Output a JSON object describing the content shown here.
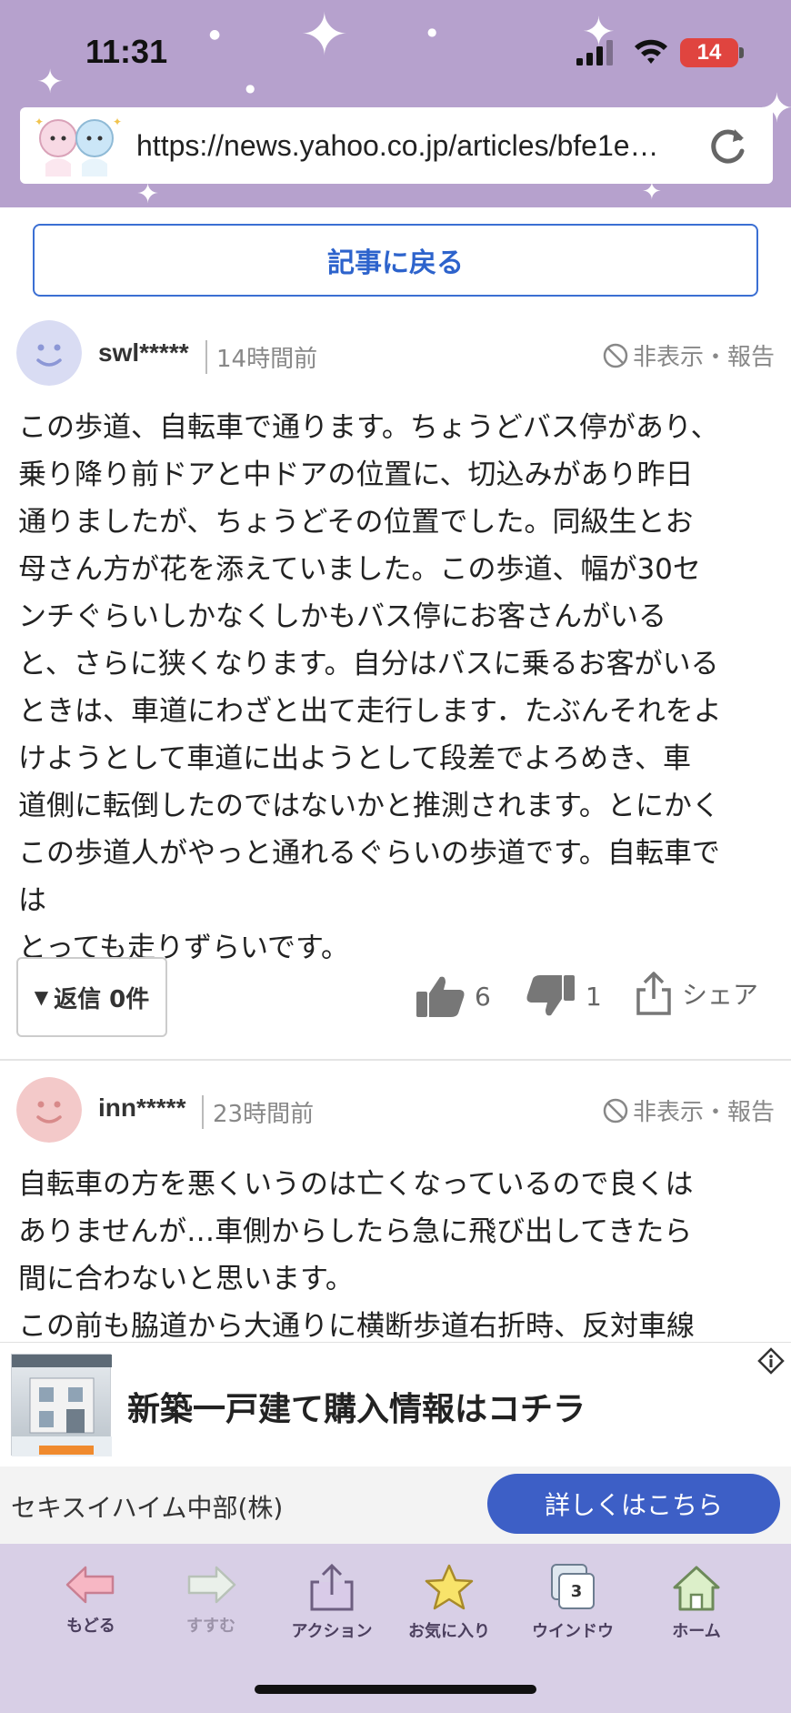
{
  "status": {
    "time": "11:31",
    "battery": "14"
  },
  "browser": {
    "url": "https://news.yahoo.co.jp/articles/bfe1e…"
  },
  "page": {
    "back_label": "記事に戻る"
  },
  "comments": [
    {
      "user": "swl*****",
      "time": "14時間前",
      "hide_report": "非表示・報告",
      "text": "この歩道、自転車で通ります。ちょうどバス停があり、\n乗り降り前ドアと中ドアの位置に、切込みがあり昨日\n通りましたが、ちょうどその位置でした。同級生とお\n母さん方が花を添えていました。この歩道、幅が30セ\nンチぐらいしかなくしかもバス停にお客さんがいる\nと、さらに狭くなります。自分はバスに乗るお客がいる\nときは、車道にわざと出て走行します．たぶんそれをよ\nけようとして車道に出ようとして段差でよろめき、車\n道側に転倒したのではないかと推測されます。とにかく\nこの歩道人がやっと通れるぐらいの歩道です。自転車で\nは\nとっても走りずらいです。",
      "reply_label": "返信 0件",
      "likes": "6",
      "dislikes": "1",
      "share_label": "シェア",
      "avatar_color": "#d9dcf3"
    },
    {
      "user": "inn*****",
      "time": "23時間前",
      "hide_report": "非表示・報告",
      "text": "自転車の方を悪くいうのは亡くなっているので良くは\nありませんが…車側からしたら急に飛び出してきたら\n間に合わないと思います。\nこの前も脇道から大通りに横断歩道右折時、反対車線",
      "avatar_color": "#f3c9c9"
    }
  ],
  "ad": {
    "title": "新築一戸建て購入情報はコチラ",
    "company": "セキスイハイム中部(株)",
    "cta": "詳しくはこちら"
  },
  "toolbar": {
    "items": [
      {
        "label": "もどる",
        "icon": "back-arrow-icon"
      },
      {
        "label": "すすむ",
        "icon": "forward-arrow-icon"
      },
      {
        "label": "アクション",
        "icon": "share-action-icon"
      },
      {
        "label": "お気に入り",
        "icon": "star-icon"
      },
      {
        "label": "ウインドウ",
        "icon": "windows-icon",
        "badge": "3"
      },
      {
        "label": "ホーム",
        "icon": "home-icon"
      }
    ]
  },
  "colors": {
    "accent": "#3b6fd3",
    "header": "#b6a1cd",
    "toolbar": "#d8cfe6"
  }
}
